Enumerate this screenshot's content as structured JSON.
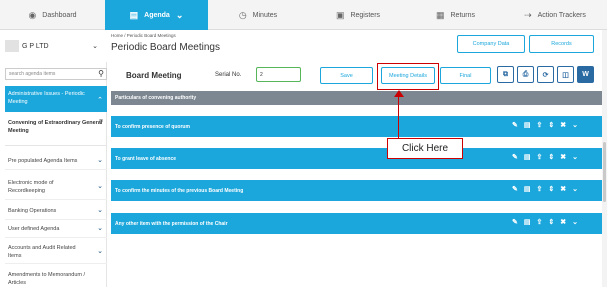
{
  "nav": [
    {
      "label": "Dashboard",
      "icon": "speedometer-icon",
      "glyph": "◉"
    },
    {
      "label": "Agenda",
      "icon": "agenda-icon",
      "glyph": "▤",
      "chevron": "⌄"
    },
    {
      "label": "Minutes",
      "icon": "clock-icon",
      "glyph": "◷"
    },
    {
      "label": "Registers",
      "icon": "folder-icon",
      "glyph": "▣"
    },
    {
      "label": "Returns",
      "icon": "document-icon",
      "glyph": "▦"
    },
    {
      "label": "Action Trackers",
      "icon": "tracker-icon",
      "glyph": "⇢"
    }
  ],
  "company": {
    "name": "G P LTD",
    "chevron": "⌄"
  },
  "breadcrumb": "Home  /  Periodic Board Meetings",
  "page_title": "Periodic Board Meetings",
  "header_buttons": {
    "company_data": "Company Data",
    "records": "Records"
  },
  "sidebar": {
    "search_placeholder": "search agenda items",
    "search_icon": "⚲",
    "active_section": "Administrative Issues - Periodic Meeting",
    "active_chevron": "⌃",
    "sub_heading": "Convening of Extraordinary General Meeting",
    "menu_glyph": "≡",
    "items": [
      {
        "label": "Pre populated Agenda Items"
      },
      {
        "label": "Electronic mode of Recordkeeping"
      },
      {
        "label": "Banking Operations"
      },
      {
        "label": "User defined Agenda"
      },
      {
        "label": "Accounts and Audit Related Items"
      },
      {
        "label": "Amendments to Memorandum / Articles"
      }
    ],
    "chevron": "⌄"
  },
  "toolbar": {
    "title": "Board Meeting",
    "serial_label": "Serial No.",
    "serial_value": "2",
    "save": "Save",
    "meeting_details": "Meeting Details",
    "final": "Final"
  },
  "export_icons": [
    {
      "name": "copy-icon",
      "glyph": "⧉"
    },
    {
      "name": "print-icon",
      "glyph": "⎙"
    },
    {
      "name": "refresh-icon",
      "glyph": "⟳"
    },
    {
      "name": "pdf-icon",
      "glyph": "◫"
    },
    {
      "name": "word-icon",
      "glyph": "W"
    }
  ],
  "gray_bar": "Particulars of convening authority",
  "agenda_items": [
    "To confirm presence of quorum",
    "To grant leave of absence",
    "To confirm the minutes of the previous Board Meeting",
    "Any other item with the permission of the Chair"
  ],
  "row_actions": [
    {
      "name": "attach-icon",
      "glyph": "✎"
    },
    {
      "name": "notes-icon",
      "glyph": "▤"
    },
    {
      "name": "upload-icon",
      "glyph": "⇪"
    },
    {
      "name": "reorder-icon",
      "glyph": "⇕"
    },
    {
      "name": "delete-icon",
      "glyph": "✖"
    },
    {
      "name": "expand-icon",
      "glyph": "⌄"
    }
  ],
  "callout": "Click Here",
  "colors": {
    "accent": "#1ca7dc",
    "gray_bar": "#7c8791",
    "highlight": "#cc0000"
  }
}
